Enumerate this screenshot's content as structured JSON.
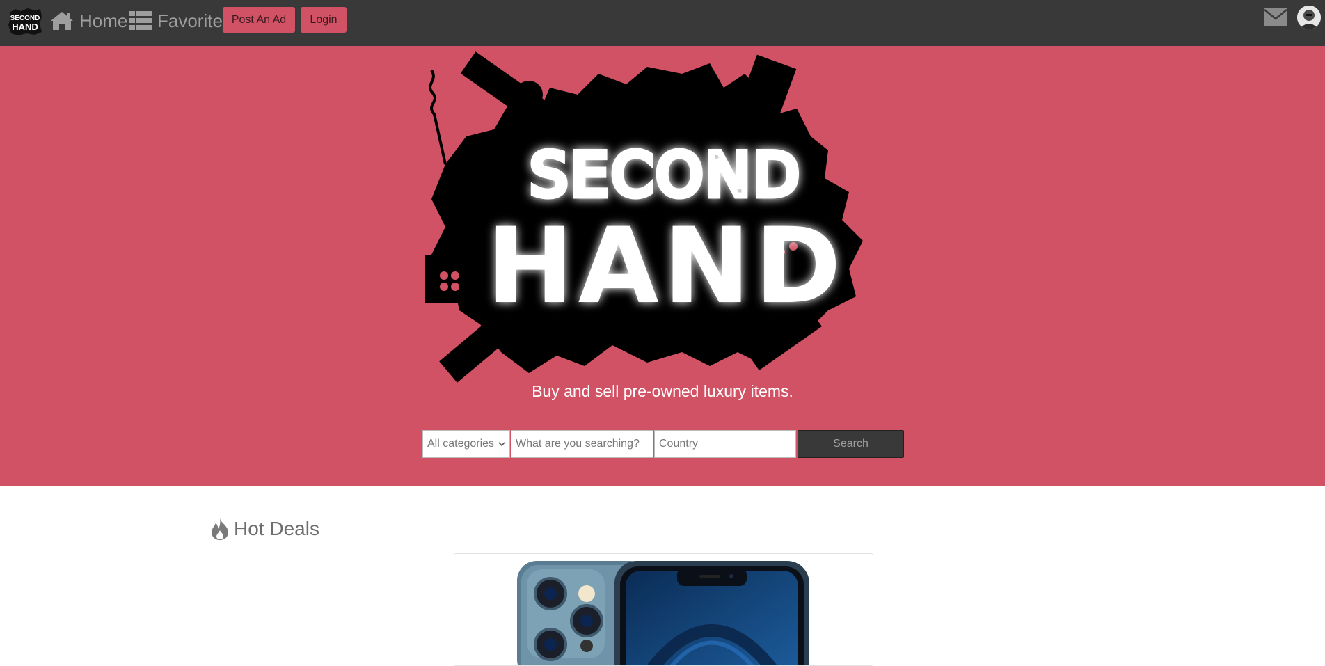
{
  "navbar": {
    "logo_text_top": "SECOND",
    "logo_text_bottom": "HAND",
    "home_label": "Home",
    "favorite_label": "Favorite",
    "post_ad_label": "Post An Ad",
    "login_label": "Login",
    "home_icon": "home-icon",
    "favorite_icon": "list-icon",
    "mail_icon": "envelope-icon",
    "avatar_icon": "user-avatar"
  },
  "hero": {
    "logo_line1": "SECOND",
    "logo_line2": "HAND",
    "tagline": "Buy and sell pre-owned luxury items.",
    "background_color": "#d15264"
  },
  "search": {
    "category_selected": "All categories",
    "query_placeholder": "What are you searching?",
    "country_placeholder": "Country",
    "button_label": "Search"
  },
  "hot_deals": {
    "title": "Hot Deals",
    "icon": "fire-icon",
    "items": [
      {
        "image": "phone-product-image"
      }
    ]
  },
  "colors": {
    "navbar": "#393939",
    "accent": "#d15264",
    "muted_text": "#9e9e9e"
  }
}
